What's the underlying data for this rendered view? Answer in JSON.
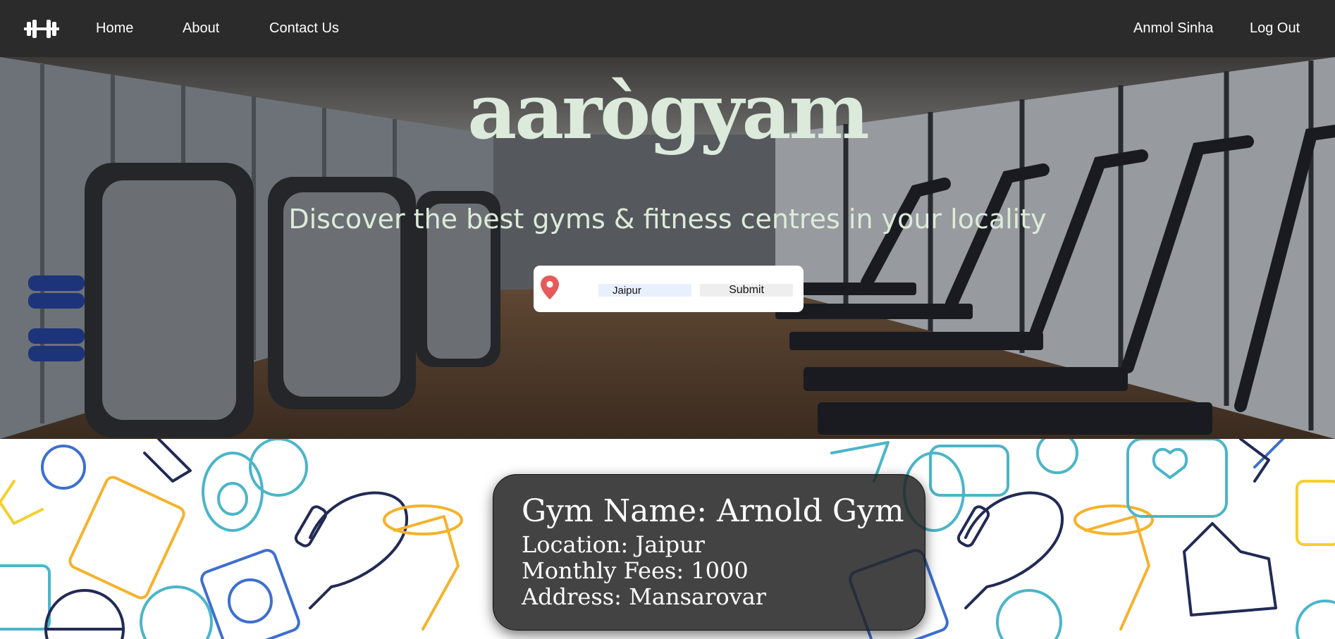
{
  "nav": {
    "logo_icon": "dumbbell-icon",
    "links": [
      "Home",
      "About",
      "Contact Us"
    ],
    "user_name": "Anmol Sinha",
    "logout_label": "Log Out"
  },
  "hero": {
    "brand": "aarògyam",
    "tagline": "Discover the best gyms & fitness centres in your locality",
    "search": {
      "pin_icon": "location-pin-icon",
      "city_value": "Jaipur",
      "submit_label": "Submit"
    }
  },
  "gym_card": {
    "name": "Gym Name: Arnold Gym",
    "location": "Location: Jaipur",
    "fees": "Monthly Fees: 1000",
    "address": "Address: Mansarovar"
  },
  "colors": {
    "navbar": "#2b2b2b",
    "brand_text": "#dbeadb",
    "pin": "#e55b5b",
    "card_bg": "#222222"
  }
}
